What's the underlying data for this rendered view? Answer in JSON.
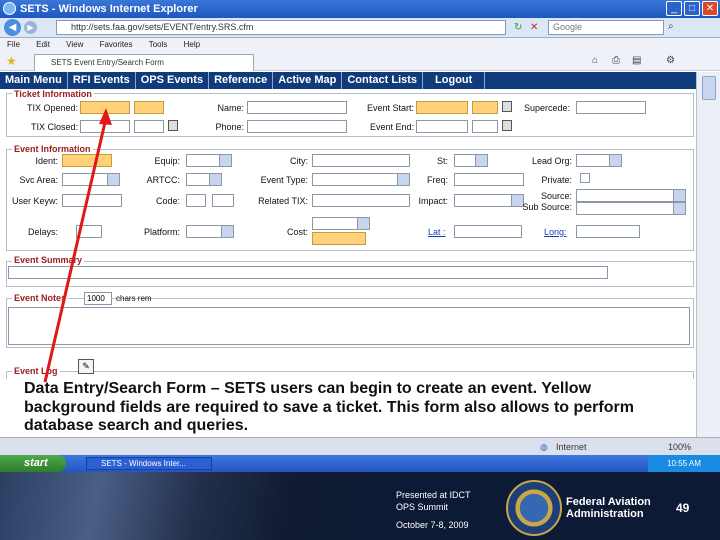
{
  "window": {
    "title": "SETS - Windows Internet Explorer"
  },
  "address": {
    "url": "http://sets.faa.gov/sets/EVENT/entry.SRS.cfm",
    "search_placeholder": "Google"
  },
  "menu": [
    "File",
    "Edit",
    "View",
    "Favorites",
    "Tools",
    "Help"
  ],
  "tab": {
    "label": "SETS Event Entry/Search Form"
  },
  "nav": [
    "Main Menu",
    "RFI Events",
    "OPS Events",
    "Reference",
    "Active Map",
    "Contact Lists",
    "Logout"
  ],
  "sections": {
    "ticket": "Ticket Information",
    "event": "Event Information",
    "summary": "Event Summary",
    "notes": "Event Notes",
    "log": "Event Log"
  },
  "fields": {
    "tix_opened": "TIX Opened:",
    "tix_closed": "TIX Closed:",
    "name": "Name:",
    "phone": "Phone:",
    "event_start": "Event Start:",
    "event_end": "Event End:",
    "supercede": "Supercede:",
    "ident": "Ident:",
    "equip": "Equip:",
    "city": "City:",
    "st": "St:",
    "lead_org": "Lead Org:",
    "svc_area": "Svc Area:",
    "artcc": "ARTCC:",
    "event_type": "Event Type:",
    "freq": "Freq:",
    "private": "Private:",
    "user_keyw": "User Keyw:",
    "code": "Code:",
    "related_tix": "Related TIX:",
    "impact": "Impact:",
    "source": "Source:",
    "sub_source": "Sub Source:",
    "delays": "Delays:",
    "platform": "Platform:",
    "cost": "Cost:",
    "lat_link": "Lat :",
    "long_link": "Long:"
  },
  "notes": {
    "counter": "1000",
    "counter_label": "chars rem"
  },
  "status": {
    "zone": "Internet",
    "zoom": "100%"
  },
  "taskbar": {
    "start": "start",
    "task": "SETS - Windows Inter...",
    "clock": "10:55 AM"
  },
  "caption": "Data Entry/Search Form – SETS users can begin to create an event. Yellow background fields are required to save a ticket. This form also allows to perform database search and queries.",
  "footer": {
    "presented": "Presented at IDCT",
    "summit": "OPS Summit",
    "date": "October 7-8, 2009",
    "agency_line1": "Federal Aviation",
    "agency_line2": "Administration",
    "page_number": "49"
  },
  "colors": {
    "nav": "#103b7b",
    "legend": "#9b1b1b",
    "required": "#ffd27a",
    "arrow": "#e01818"
  }
}
